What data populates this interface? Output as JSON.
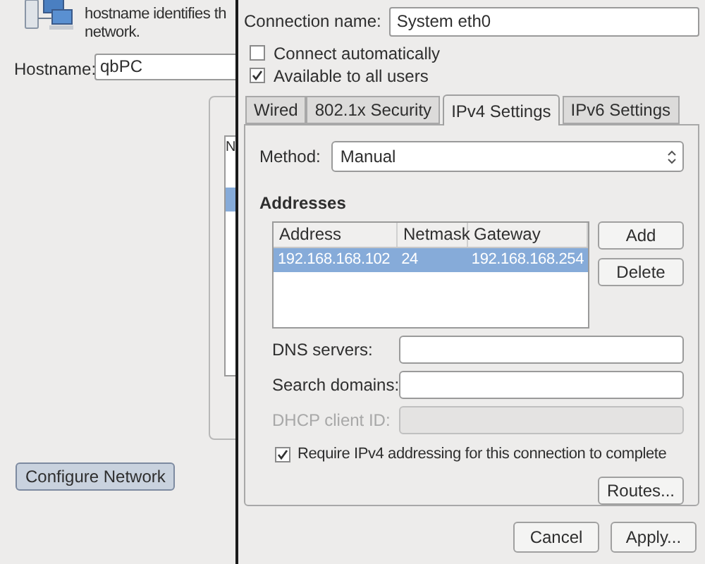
{
  "background_window": {
    "intro_lines": [
      "hostname identifies th",
      "network."
    ],
    "hostname": {
      "label": "Hostname:",
      "value": "qbPC"
    },
    "list": {
      "column_1": "N"
    },
    "configure_button": "Configure Network"
  },
  "dialog": {
    "connection_name": {
      "label": "Connection name:",
      "value": "System eth0"
    },
    "options": [
      {
        "label": "Connect automatically",
        "checked": false
      },
      {
        "label": "Available to all users",
        "checked": true
      }
    ],
    "tabs": [
      {
        "label": "Wired",
        "selected": false
      },
      {
        "label": "802.1x Security",
        "selected": false
      },
      {
        "label": "IPv4 Settings",
        "selected": true
      },
      {
        "label": "IPv6 Settings",
        "selected": false
      }
    ],
    "method": {
      "label": "Method:",
      "value": "Manual"
    },
    "addresses": {
      "title": "Addresses",
      "columns": [
        "Address",
        "Netmask",
        "Gateway"
      ],
      "rows": [
        {
          "cells": [
            "192.168.168.102",
            "24",
            "192.168.168.254"
          ],
          "selected": true
        }
      ],
      "buttons": [
        "Add",
        "Delete"
      ]
    },
    "fields": [
      {
        "label": "DNS servers:",
        "disabled": false
      },
      {
        "label": "Search domains:",
        "disabled": false
      },
      {
        "label": "DHCP client ID:",
        "disabled": true
      }
    ],
    "require": {
      "label": "Require IPv4 addressing for this connection to complete",
      "checked": true
    },
    "routes_button": "Routes...",
    "buttons": [
      "Cancel",
      "Apply..."
    ]
  }
}
